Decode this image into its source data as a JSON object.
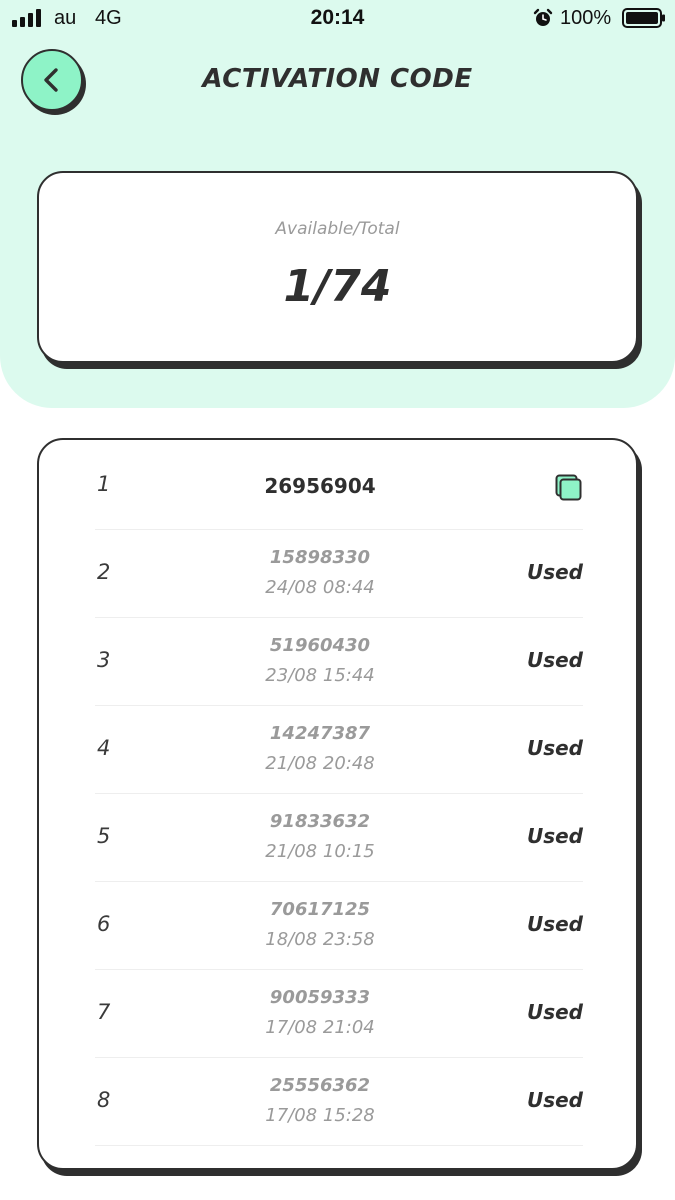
{
  "status_bar": {
    "carrier": "au",
    "network": "4G",
    "time": "20:14",
    "battery": "100%",
    "alarm_icon": "alarm-clock-icon"
  },
  "header": {
    "title": "ACTIVATION CODE",
    "back_icon": "chevron-left-icon"
  },
  "summary": {
    "label": "Available/Total",
    "value": "1/74"
  },
  "codes": [
    {
      "index": "1",
      "code": "26956904",
      "date": "",
      "status": "",
      "action_icon": "copy-icon"
    },
    {
      "index": "2",
      "code": "15898330",
      "date": "24/08 08:44",
      "status": "Used"
    },
    {
      "index": "3",
      "code": "51960430",
      "date": "23/08 15:44",
      "status": "Used"
    },
    {
      "index": "4",
      "code": "14247387",
      "date": "21/08 20:48",
      "status": "Used"
    },
    {
      "index": "5",
      "code": "91833632",
      "date": "21/08 10:15",
      "status": "Used"
    },
    {
      "index": "6",
      "code": "70617125",
      "date": "18/08 23:58",
      "status": "Used"
    },
    {
      "index": "7",
      "code": "90059333",
      "date": "17/08 21:04",
      "status": "Used"
    },
    {
      "index": "8",
      "code": "25556362",
      "date": "17/08 15:28",
      "status": "Used"
    }
  ],
  "colors": {
    "header_background": "#dcfaee",
    "accent": "#8ef3c7",
    "outline": "#2f2f2f",
    "muted_text": "#9a9a9a"
  }
}
